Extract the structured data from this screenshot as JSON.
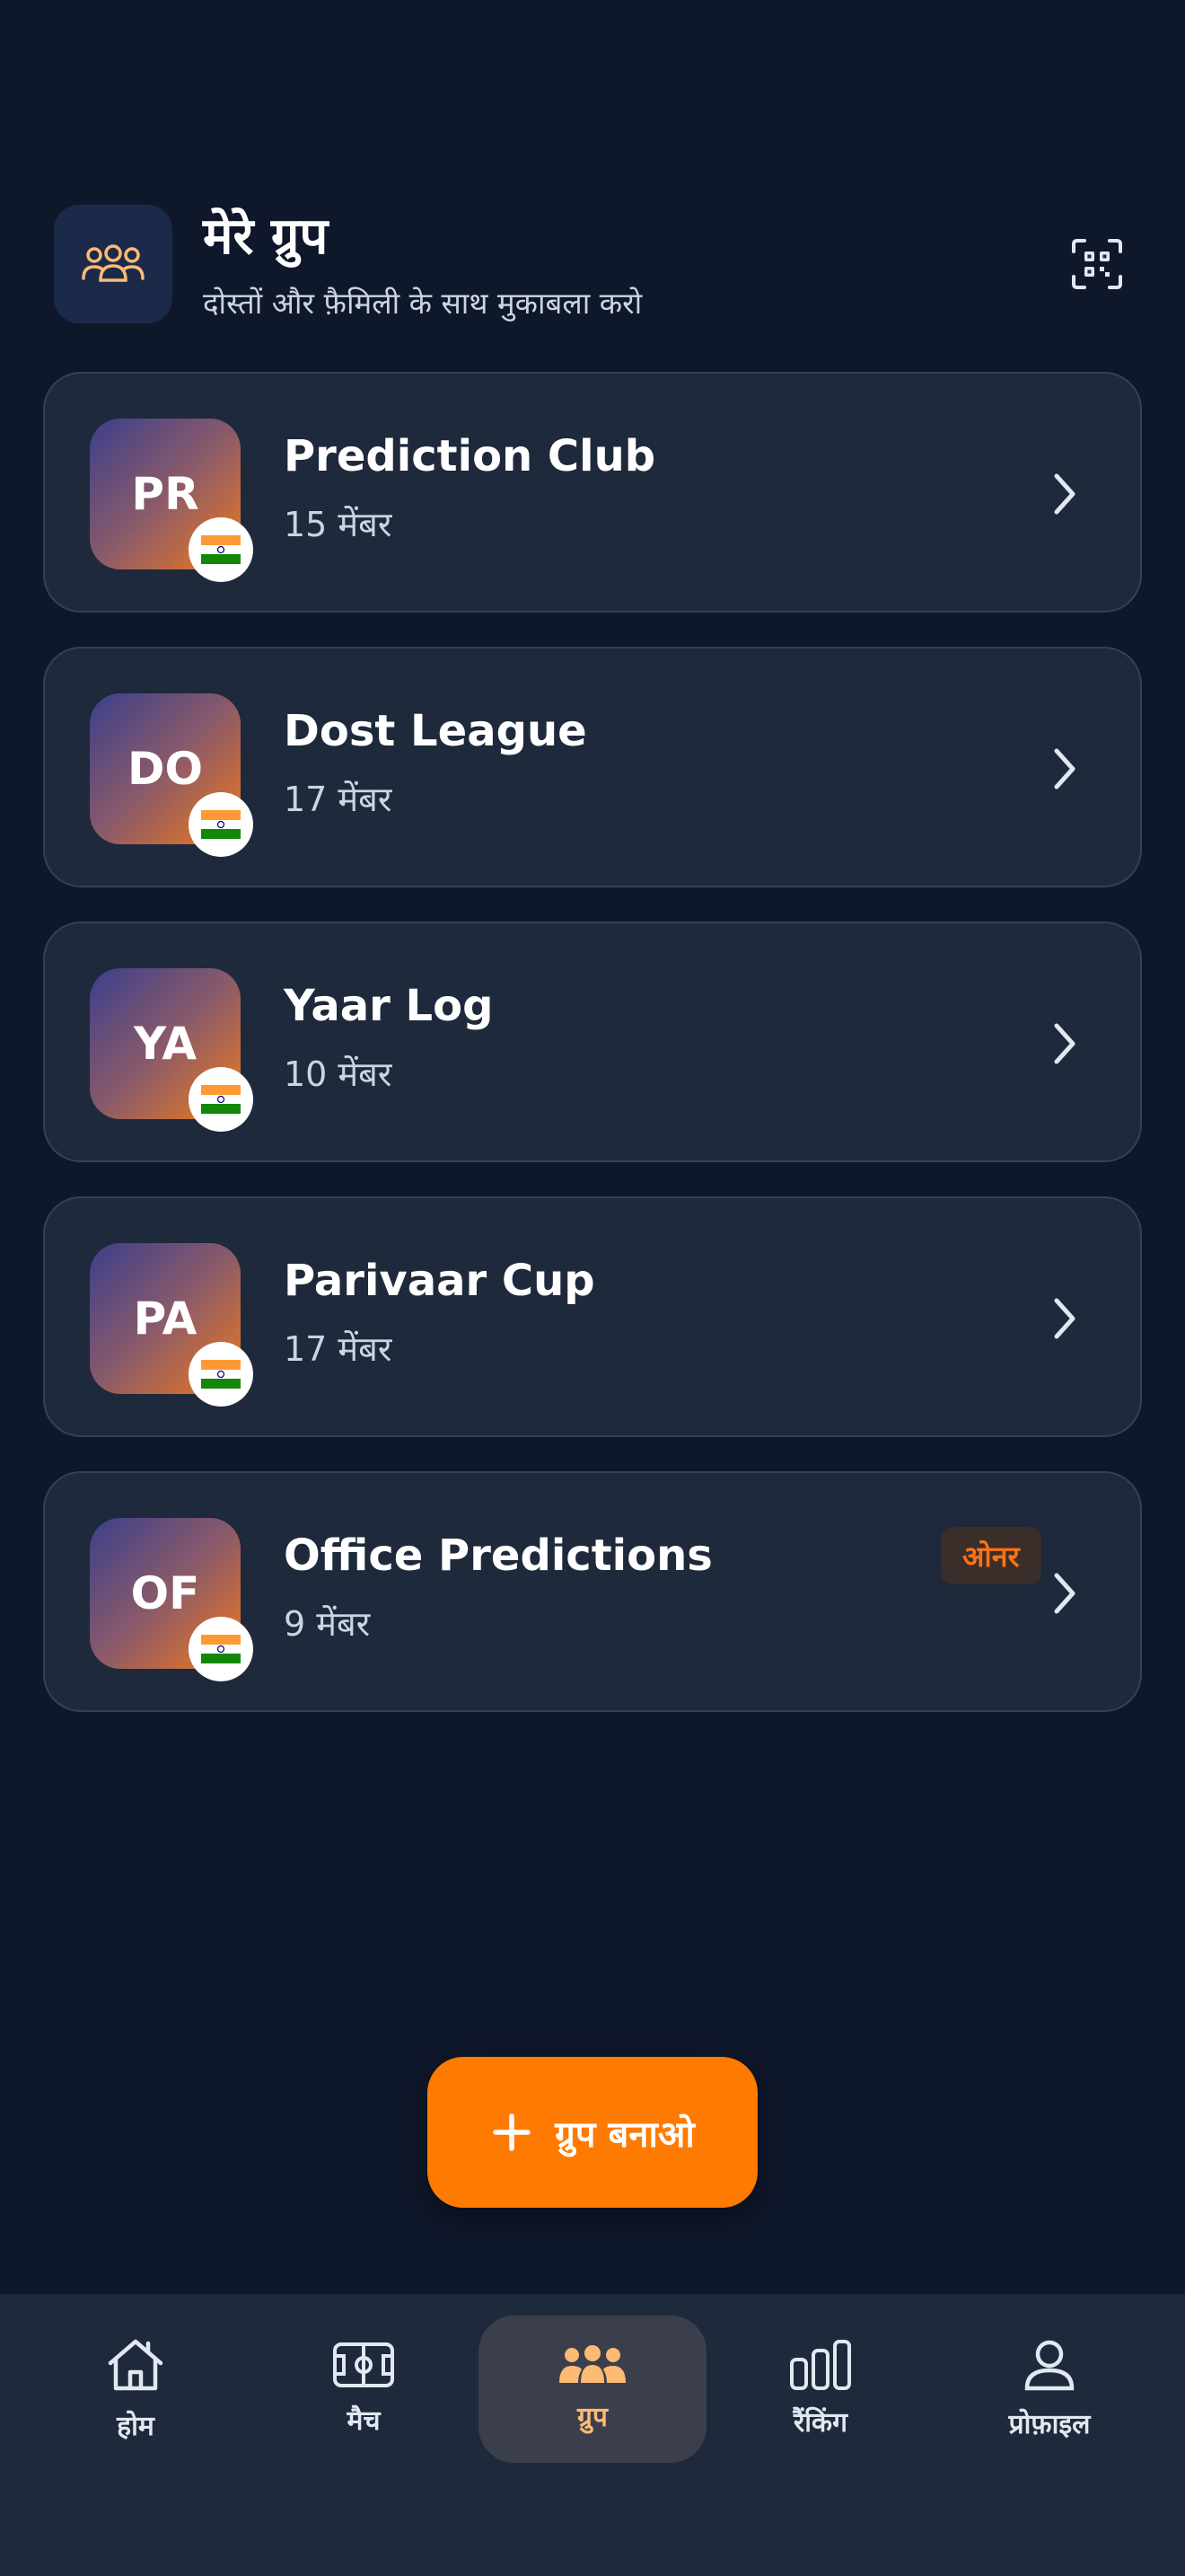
{
  "header": {
    "icon": "group-icon",
    "title": "मेरे ग्रुप",
    "subtitle": "दोस्तों और फ़ैमिली के साथ मुकाबला करो",
    "qr_icon": "qr-scan-icon"
  },
  "groups": [
    {
      "initials": "PR",
      "name": "Prediction Club",
      "members": "15 मेंबर",
      "flag": "india-flag-icon",
      "owner": false
    },
    {
      "initials": "DO",
      "name": "Dost League",
      "members": "17 मेंबर",
      "flag": "india-flag-icon",
      "owner": false
    },
    {
      "initials": "YA",
      "name": "Yaar Log",
      "members": "10 मेंबर",
      "flag": "india-flag-icon",
      "owner": false
    },
    {
      "initials": "PA",
      "name": "Parivaar Cup",
      "members": "17 मेंबर",
      "flag": "india-flag-icon",
      "owner": false
    },
    {
      "initials": "OF",
      "name": "Office Predictions",
      "members": "9 मेंबर",
      "flag": "india-flag-icon",
      "owner": true,
      "owner_label": "ओनर"
    }
  ],
  "create_button": {
    "label": "ग्रुप बनाओ",
    "icon": "plus-icon"
  },
  "nav": [
    {
      "label": "होम",
      "icon": "home-icon",
      "active": false
    },
    {
      "label": "मैच",
      "icon": "pitch-icon",
      "active": false
    },
    {
      "label": "ग्रुप",
      "icon": "group-icon",
      "active": true
    },
    {
      "label": "रैंकिंग",
      "icon": "ranking-icon",
      "active": false
    },
    {
      "label": "प्रोफ़ाइल",
      "icon": "profile-icon",
      "active": false
    }
  ],
  "colors": {
    "background": "#0f172a",
    "card": "#1e293b",
    "accent": "#ff7a00",
    "active_nav_text": "#fdba74"
  }
}
